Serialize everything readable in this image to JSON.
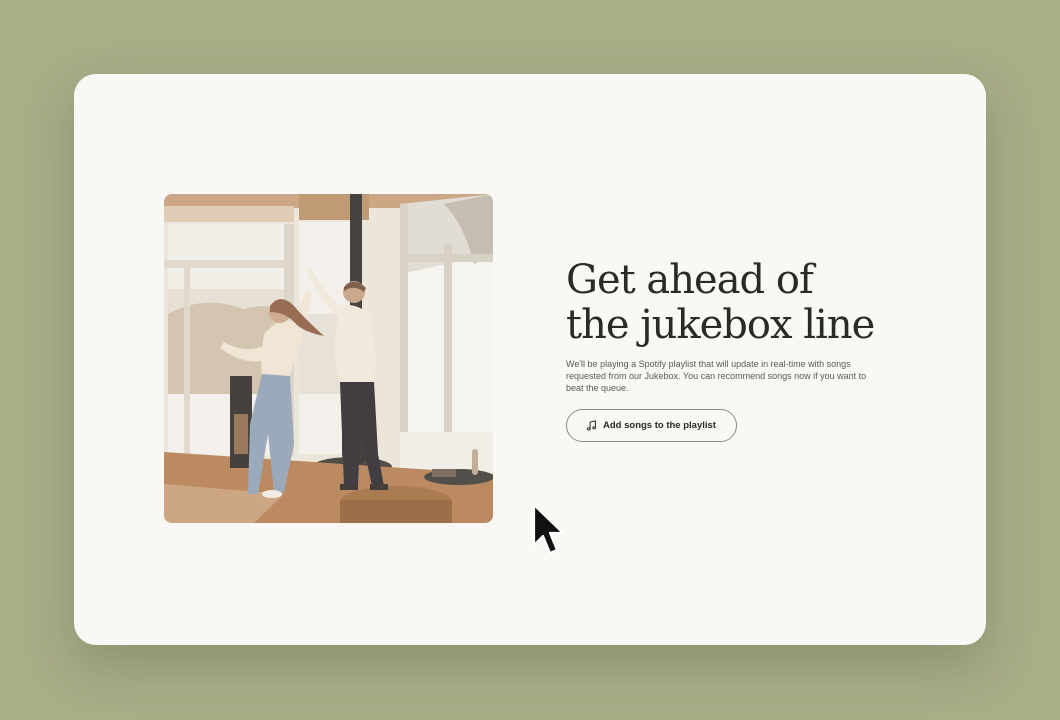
{
  "background_color": "#a9ad88",
  "card_color": "#faf8f4",
  "hero": {
    "image_icon": "photo-couple-dancing",
    "headline": "Get ahead of\nthe jukebox line",
    "description": "We'll be playing a Spotify playlist that will update in real-time with songs requested from our Jukebox. You can recommend songs now if you want to beat the queue.",
    "cta": {
      "icon": "music-note-icon",
      "label": "Add songs to the playlist"
    }
  },
  "cursor": "mouse-pointer-icon"
}
